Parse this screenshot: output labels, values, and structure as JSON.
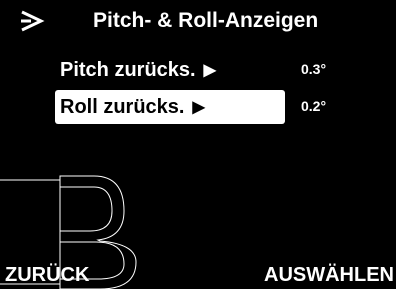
{
  "header": {
    "title": "Pitch- & Roll-Anzeigen",
    "icon": "pitch-roll-icon"
  },
  "menu": {
    "items": [
      {
        "label": "Pitch zurücks.",
        "arrow": "▶",
        "value": "0.3°",
        "selected": false
      },
      {
        "label": "Roll zurücks.",
        "arrow": "▶",
        "value": "0.2°",
        "selected": true
      }
    ]
  },
  "softkeys": {
    "left": "ZURÜCK",
    "right": "AUSWÄHLEN"
  },
  "colors": {
    "background": "#000000",
    "text": "#ffffff",
    "highlight": "#ffffff",
    "highlight_text": "#000000"
  }
}
